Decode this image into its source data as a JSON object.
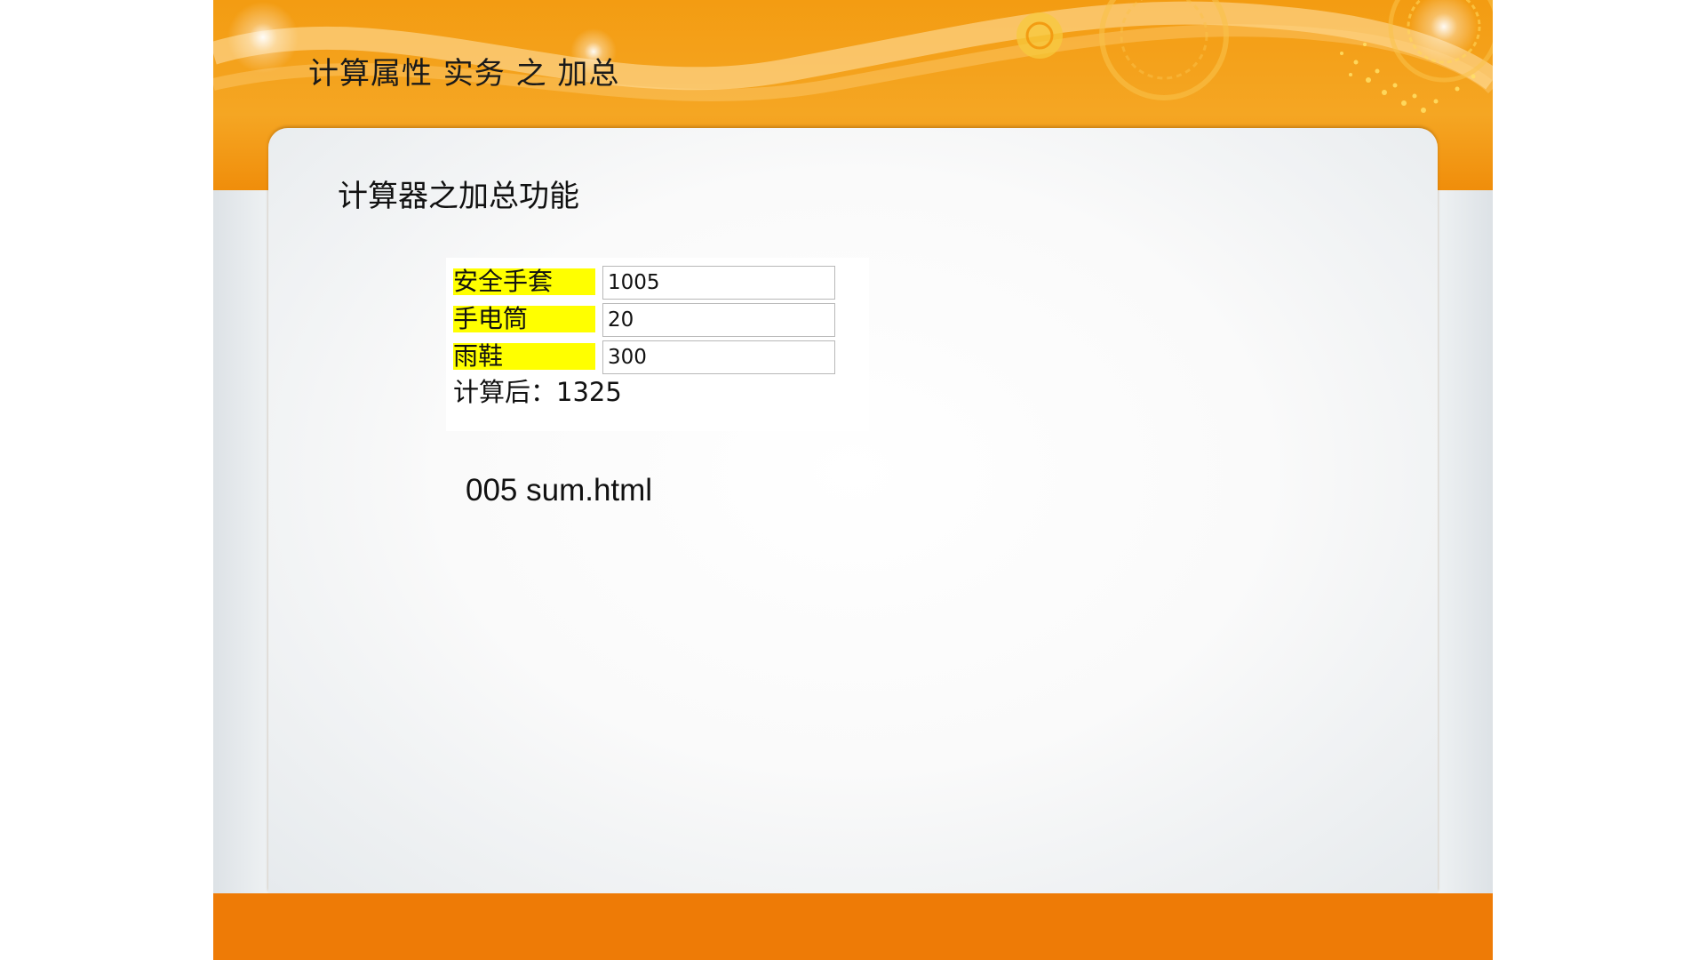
{
  "slide": {
    "title": "计算属性 实务 之 加总",
    "section_title": "计算器之加总功能",
    "filename": "005 sum.html"
  },
  "calculator": {
    "items": [
      {
        "label": "安全手套",
        "value": "1005"
      },
      {
        "label": "手电筒",
        "value": "20"
      },
      {
        "label": "雨鞋",
        "value": "300"
      }
    ],
    "result_label": "计算后：",
    "result_value": "1325"
  },
  "colors": {
    "header_orange": "#f5a623",
    "footer_orange": "#ee7b06",
    "label_highlight": "#ffff00"
  }
}
